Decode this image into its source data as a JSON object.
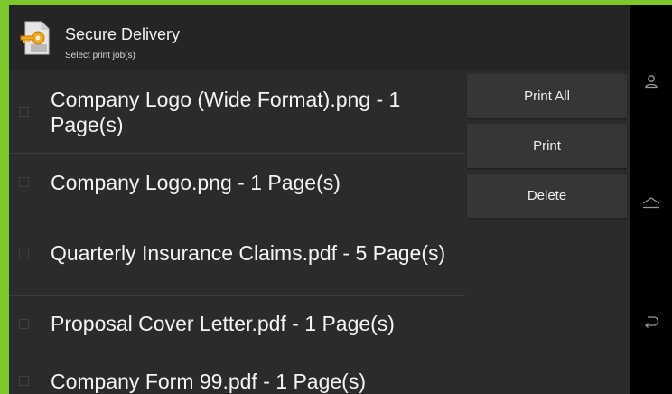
{
  "app": {
    "title": "Secure Delivery",
    "subtitle": "Select print job(s)",
    "icon": "secure-document-key-icon"
  },
  "jobs": [
    {
      "label": "Company Logo (Wide Format).png - 1 Page(s)",
      "checked": false
    },
    {
      "label": "Company Logo.png - 1 Page(s)",
      "checked": false
    },
    {
      "label": "Quarterly Insurance Claims.pdf - 5 Page(s)",
      "checked": false
    },
    {
      "label": "Proposal Cover Letter.pdf - 1 Page(s)",
      "checked": false
    },
    {
      "label": "Company Form 99.pdf - 1 Page(s)",
      "checked": false
    }
  ],
  "actions": {
    "print_all": "Print All",
    "print": "Print",
    "delete": "Delete"
  },
  "nav": [
    "person-icon",
    "home-icon",
    "back-icon"
  ],
  "colors": {
    "frame": "#7cc82a",
    "background": "#2b2b2b",
    "appbar": "#252525",
    "button": "#363636",
    "navbar": "#000000"
  }
}
